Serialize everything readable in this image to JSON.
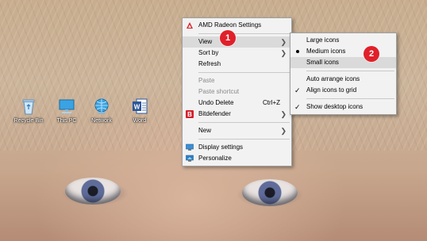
{
  "desktop": {
    "icons": [
      {
        "label": "Recycle Bin",
        "icon": "recycle-bin-icon"
      },
      {
        "label": "This PC",
        "icon": "computer-icon"
      },
      {
        "label": "Network",
        "icon": "network-icon"
      },
      {
        "label": "Word",
        "icon": "word-icon"
      }
    ]
  },
  "context_menu": {
    "items": [
      {
        "label": "AMD Radeon Settings",
        "icon": "amd-radeon-icon"
      },
      {
        "label": "View"
      },
      {
        "label": "Sort by"
      },
      {
        "label": "Refresh"
      },
      {
        "label": "Paste"
      },
      {
        "label": "Paste shortcut"
      },
      {
        "label": "Undo Delete",
        "shortcut": "Ctrl+Z"
      },
      {
        "label": "Bitdefender",
        "icon": "bitdefender-icon"
      },
      {
        "label": "New"
      },
      {
        "label": "Display settings",
        "icon": "display-icon"
      },
      {
        "label": "Personalize",
        "icon": "personalize-icon"
      }
    ]
  },
  "view_submenu": {
    "items": [
      {
        "label": "Large icons"
      },
      {
        "label": "Medium icons",
        "selected": true
      },
      {
        "label": "Small icons"
      },
      {
        "label": "Auto arrange icons"
      },
      {
        "label": "Align icons to grid",
        "checked": true
      },
      {
        "label": "Show desktop icons",
        "checked": true
      }
    ]
  },
  "annotations": {
    "step1": "1",
    "step2": "2"
  },
  "colors": {
    "badge": "#e0202a",
    "menu_bg": "#f2f2f2",
    "highlight": "#dadada"
  }
}
